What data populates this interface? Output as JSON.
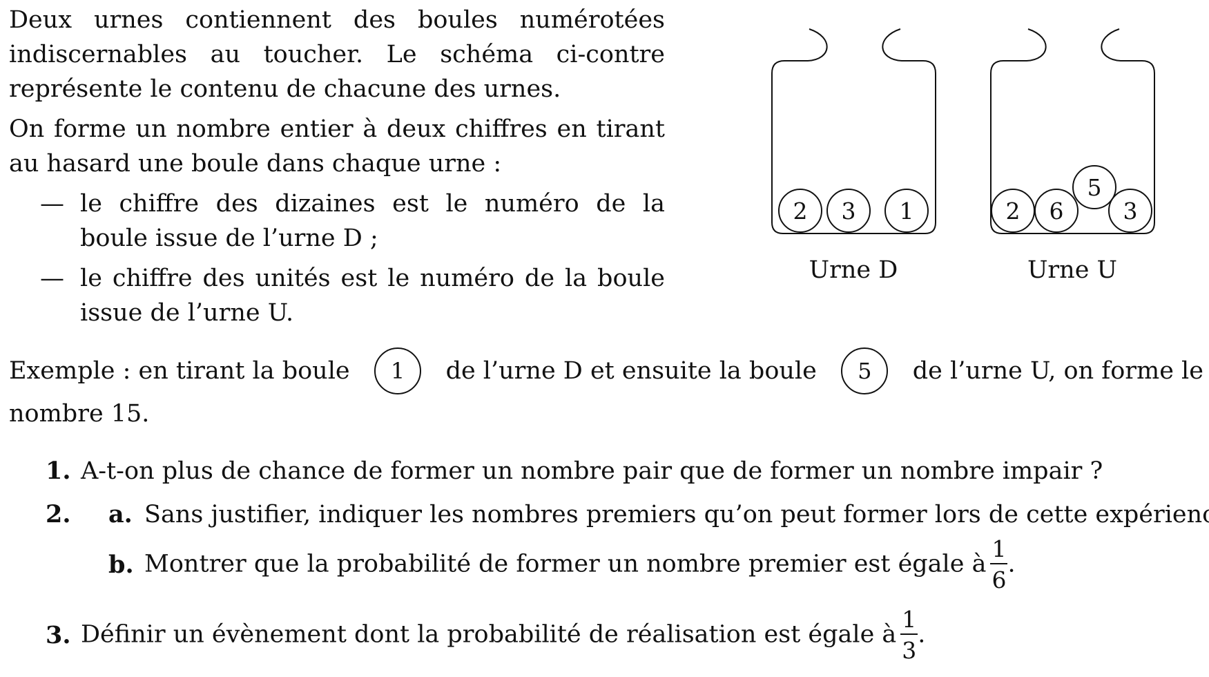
{
  "intro": {
    "p1": "Deux urnes contiennent des boules numérotées indiscernables au toucher. Le schéma ci-contre représente le contenu de chacune des urnes.",
    "p2": "On forme un nombre entier à deux chiffres en tirant au hasard une boule dans chaque urne :",
    "bullets": [
      "le chiffre des dizaines est le numéro de la boule issue de l’urne D ;",
      "le chiffre des unités est le numéro de la boule issue de l’urne U."
    ],
    "dash": "—"
  },
  "urns": {
    "urn_d": {
      "label": "Urne D",
      "balls": [
        "2",
        "3",
        "1"
      ]
    },
    "urn_u": {
      "label": "Urne U",
      "balls": [
        "2",
        "6",
        "5",
        "3"
      ]
    }
  },
  "example": {
    "part1": "Exemple : en tirant la boule",
    "ball1": "1",
    "part2": "de l’urne D et ensuite la boule",
    "ball2": "5",
    "part3": "de l’urne U, on forme le",
    "line2": "nombre 15."
  },
  "questions": {
    "q1": {
      "num": "1.",
      "text": "A-t-on plus de chance de former un nombre pair que de former un nombre impair ?"
    },
    "q2": {
      "num": "2.",
      "a": {
        "num": "a.",
        "text": "Sans justifier, indiquer les nombres premiers qu’on peut former lors de cette expérience."
      },
      "b": {
        "num": "b.",
        "text": "Montrer que la probabilité de former un nombre premier est égale à",
        "frac_num": "1",
        "frac_den": "6",
        "end": "."
      }
    },
    "q3": {
      "num": "3.",
      "text": "Définir un évènement dont la probabilité de réalisation est égale à",
      "frac_num": "1",
      "frac_den": "3",
      "end": "."
    }
  }
}
